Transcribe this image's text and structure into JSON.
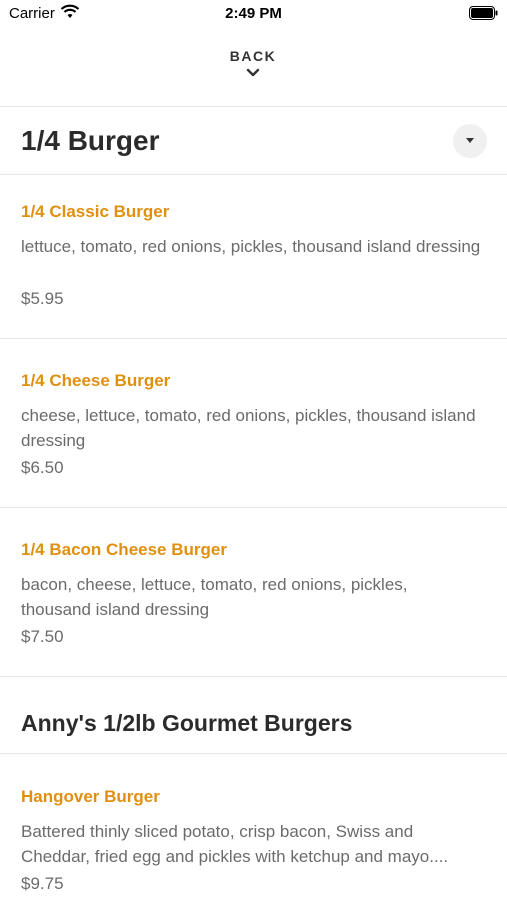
{
  "status_bar": {
    "carrier": "Carrier",
    "time": "2:49 PM"
  },
  "nav": {
    "back_label": "BACK"
  },
  "sections": [
    {
      "title": "1/4 Burger",
      "items": [
        {
          "name": "1/4 Classic Burger",
          "description": "lettuce, tomato, red onions, pickles, thousand island dressing",
          "price": "$5.95"
        },
        {
          "name": "1/4 Cheese Burger",
          "description": "cheese, lettuce, tomato, red onions, pickles, thousand island dressing",
          "price": "$6.50"
        },
        {
          "name": "1/4 Bacon Cheese Burger",
          "description": "bacon, cheese, lettuce, tomato, red onions, pickles, thousand island dressing",
          "price": "$7.50"
        }
      ]
    },
    {
      "title": "Anny's 1/2lb Gourmet Burgers",
      "items": [
        {
          "name": "Hangover Burger",
          "description": "Battered thinly sliced potato, crisp bacon, Swiss and Cheddar, fried egg and pickles with ketchup and mayo....",
          "price": "$9.75"
        }
      ]
    }
  ],
  "colors": {
    "accent": "#e0900f",
    "text": "#2b2b2b",
    "muted": "#6b6b6b"
  }
}
